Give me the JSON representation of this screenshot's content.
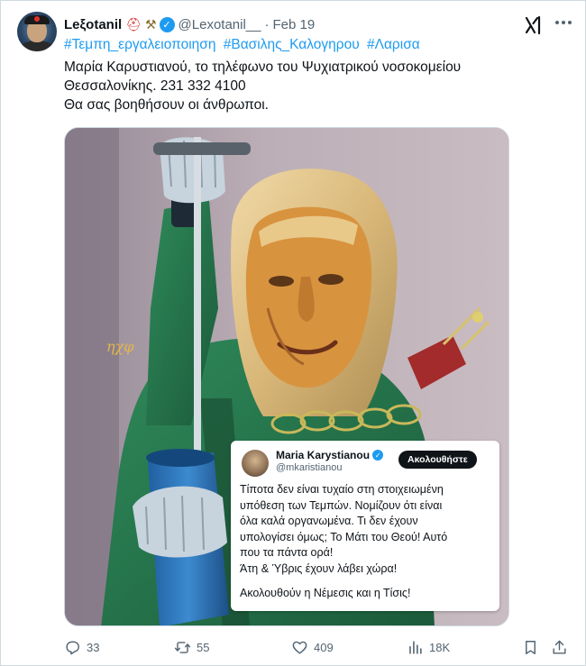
{
  "tweet": {
    "author": {
      "display_name": "Leξotanil",
      "emojis": [
        "⛑",
        "⚒"
      ],
      "handle": "@Lexotanil__",
      "date": "Feb 19",
      "verified": true
    },
    "hashtags": [
      "#Τεμπη_εργαλειοποιηση",
      "#Βασιλης_Καλογηρου",
      "#Λαρισα"
    ],
    "body_lines": [
      "Μαρία Καρυστιανού, το τηλέφωνο του Ψυχιατρικού νοσοκομείου",
      "Θεσσαλονίκης. 231 332 4100",
      "Θα σας βοηθήσουν οι άνθρωποι."
    ],
    "media": {
      "artist_signature": "ηχφ",
      "quote_card": {
        "name": "Maria Karystianou",
        "handle": "@mkaristianou",
        "follow_label": "Ακολουθήστε",
        "text_lines": [
          "Τίποτα δεν είναι τυχαίο στη στοιχειωμένη",
          "υπόθεση των Τεμπών. Νομίζουν ότι είναι",
          "όλα καλά οργανωμένα. Τι  δεν έχουν",
          "υπολογίσει όμως; Το Μάτι του Θεού! Αυτό",
          "που τα πάντα ορά!",
          "Άτη & Ύβρις  έχουν λάβει  χώρα!"
        ],
        "closing_line": "Ακολουθούν η Νέμεσις και η Τίσις!"
      }
    },
    "actions": {
      "replies": "33",
      "reposts": "55",
      "likes": "409",
      "views": "18K"
    }
  },
  "icons": {
    "grok": "grok-icon",
    "more": "more-icon",
    "reply": "reply-icon",
    "repost": "repost-icon",
    "like": "heart-icon",
    "views": "views-icon",
    "bookmark": "bookmark-icon",
    "share": "share-icon"
  },
  "colors": {
    "accent": "#1d9bf0",
    "text": "#0f1419",
    "secondary": "#536471"
  }
}
